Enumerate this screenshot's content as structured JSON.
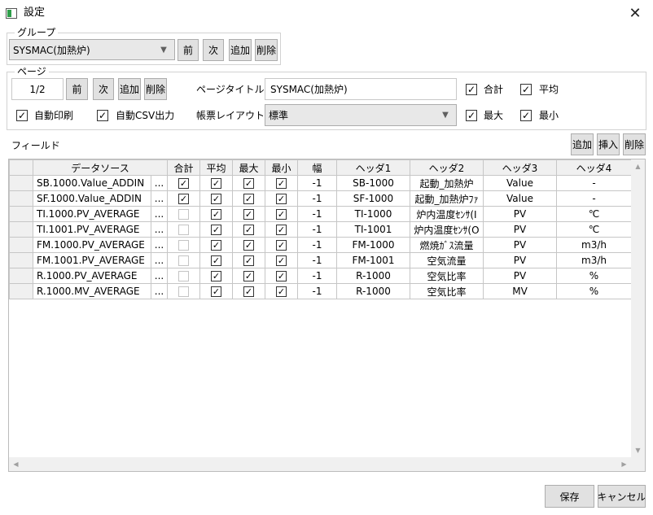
{
  "window": {
    "title": "設定"
  },
  "group": {
    "legend": "グループ",
    "selected": "SYSMAC(加熱炉)",
    "buttons": [
      "前",
      "次",
      "追加",
      "削除"
    ]
  },
  "page": {
    "legend": "ページ",
    "number": "1/2",
    "buttons": [
      "前",
      "次",
      "追加",
      "削除"
    ],
    "title_label": "ページタイトル：",
    "title_value": "SYSMAC(加熱炉)",
    "layout_label": "帳票レイアウト：",
    "layout_value": "標準",
    "auto_print": {
      "label": "自動印刷",
      "checked": true
    },
    "auto_csv": {
      "label": "自動CSV出力",
      "checked": true
    },
    "sum": {
      "label": "合計",
      "checked": true
    },
    "avg": {
      "label": "平均",
      "checked": true
    },
    "max": {
      "label": "最大",
      "checked": true
    },
    "min": {
      "label": "最小",
      "checked": true
    }
  },
  "fields": {
    "label": "フィールド",
    "buttons": [
      "追加",
      "挿入",
      "削除"
    ],
    "columns": [
      "データソース",
      "合計",
      "平均",
      "最大",
      "最小",
      "幅",
      "ヘッダ1",
      "ヘッダ2",
      "ヘッダ3",
      "ヘッダ4"
    ],
    "ellipsis": "...",
    "rows": [
      {
        "source": "SB.1000.Value_ADDIN",
        "sum": true,
        "avg": true,
        "max": true,
        "min": true,
        "width": "-1",
        "h1": "SB-1000",
        "h2": "起動_加熱炉",
        "h3": "Value",
        "h4": "-"
      },
      {
        "source": "SF.1000.Value_ADDIN",
        "sum": true,
        "avg": true,
        "max": true,
        "min": true,
        "width": "-1",
        "h1": "SF-1000",
        "h2": "起動_加熱炉ﾌｧ",
        "h3": "Value",
        "h4": "-"
      },
      {
        "source": "TI.1000.PV_AVERAGE",
        "sum": false,
        "avg": true,
        "max": true,
        "min": true,
        "width": "-1",
        "h1": "TI-1000",
        "h2": "炉内温度ｾﾝｻ(I",
        "h3": "PV",
        "h4": "℃"
      },
      {
        "source": "TI.1001.PV_AVERAGE",
        "sum": false,
        "avg": true,
        "max": true,
        "min": true,
        "width": "-1",
        "h1": "TI-1001",
        "h2": "炉内温度ｾﾝｻ(O",
        "h3": "PV",
        "h4": "℃"
      },
      {
        "source": "FM.1000.PV_AVERAGE",
        "sum": false,
        "avg": true,
        "max": true,
        "min": true,
        "width": "-1",
        "h1": "FM-1000",
        "h2": "燃焼ｶﾞｽ流量",
        "h3": "PV",
        "h4": "m3/h"
      },
      {
        "source": "FM.1001.PV_AVERAGE",
        "sum": false,
        "avg": true,
        "max": true,
        "min": true,
        "width": "-1",
        "h1": "FM-1001",
        "h2": "空気流量",
        "h3": "PV",
        "h4": "m3/h"
      },
      {
        "source": "R.1000.PV_AVERAGE",
        "sum": false,
        "avg": true,
        "max": true,
        "min": true,
        "width": "-1",
        "h1": "R-1000",
        "h2": "空気比率",
        "h3": "PV",
        "h4": "%"
      },
      {
        "source": "R.1000.MV_AVERAGE",
        "sum": false,
        "avg": true,
        "max": true,
        "min": true,
        "width": "-1",
        "h1": "R-1000",
        "h2": "空気比率",
        "h3": "MV",
        "h4": "%"
      }
    ]
  },
  "footer": {
    "save": "保存",
    "cancel": "キャンセル"
  },
  "icons": {
    "app": "window-icon",
    "close": "close-icon",
    "combo": "chevron-down-icon",
    "scroll_up": "arrow-up-icon",
    "scroll_down": "arrow-down-icon",
    "scroll_left": "arrow-left-icon",
    "scroll_right": "arrow-right-icon"
  },
  "colors": {
    "button_bg": "#e1e1e1",
    "grid_header": "#f0f0f0",
    "icon_green": "#2e9e4a"
  }
}
